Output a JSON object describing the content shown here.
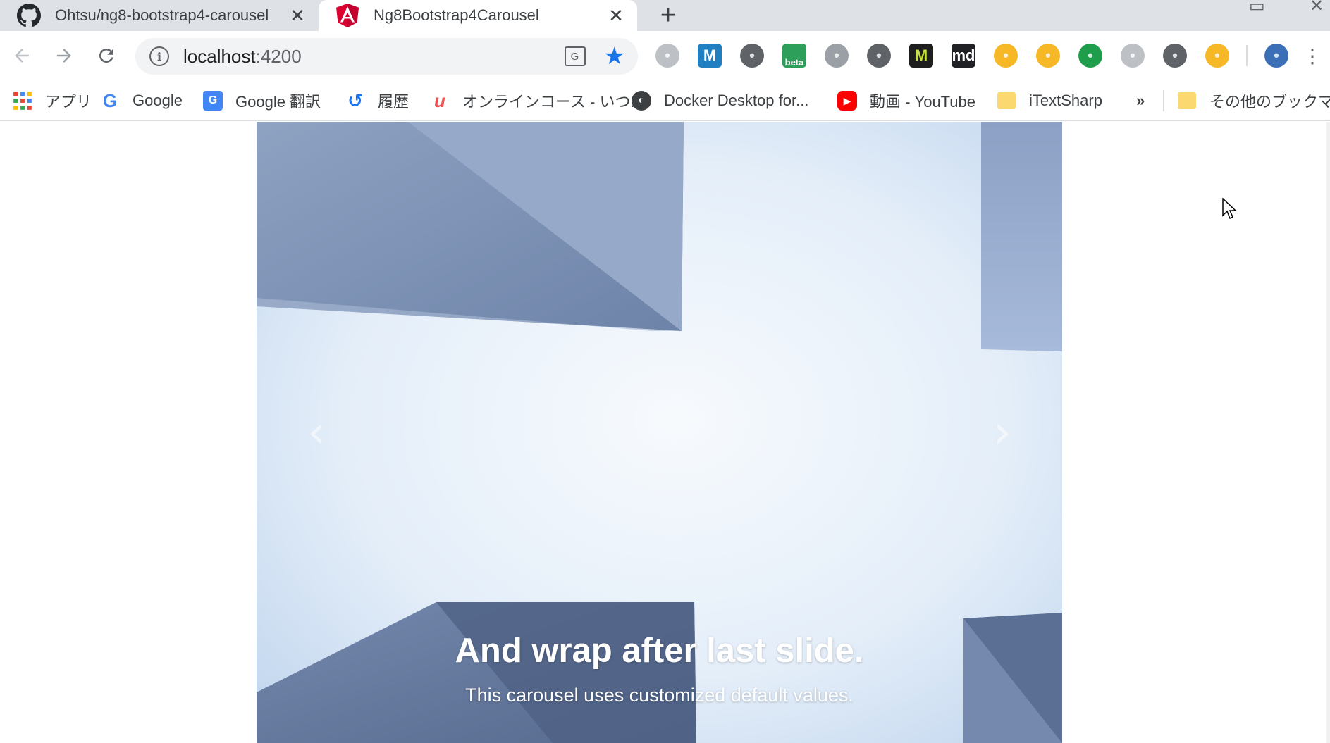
{
  "tabs": [
    {
      "title": "Ohtsu/ng8-bootstrap4-carousel",
      "icon": "github-icon",
      "active": false
    },
    {
      "title": "Ng8Bootstrap4Carousel",
      "icon": "angular-icon",
      "active": true
    }
  ],
  "new_tab_label": "+",
  "address_bar": {
    "host": "localhost",
    "port": ":4200"
  },
  "extensions": [
    {
      "name": "shield-extension-icon",
      "color": "#bdc1c6",
      "label": ""
    },
    {
      "name": "m-blue-extension-icon",
      "color": "#1f7fc0",
      "label": "M"
    },
    {
      "name": "film-reel-extension-icon",
      "color": "#5f6368",
      "label": ""
    },
    {
      "name": "beta-extension-icon",
      "color": "#2e9e5b",
      "label": "beta"
    },
    {
      "name": "chart-extension-icon",
      "color": "#9aa0a6",
      "label": ""
    },
    {
      "name": "magnifier-extension-icon",
      "color": "#5f6368",
      "label": ""
    },
    {
      "name": "m-yellow-extension-icon",
      "color": "#1e1e1e",
      "label": "M"
    },
    {
      "name": "md-extension-icon",
      "color": "#202124",
      "label": "md"
    },
    {
      "name": "search-orange-extension-icon",
      "color": "#f6b826",
      "label": ""
    },
    {
      "name": "home-extension-icon",
      "color": "#f6b826",
      "label": ""
    },
    {
      "name": "checkmark-extension-icon",
      "color": "#1e9e4a",
      "label": ""
    },
    {
      "name": "circle-extension-icon",
      "color": "#bdc1c6",
      "label": ""
    },
    {
      "name": "zoom-extension-icon",
      "color": "#5f6368",
      "label": ""
    },
    {
      "name": "moon-extension-icon",
      "color": "#f6b826",
      "label": ""
    },
    {
      "name": "profile-extension-icon",
      "color": "#3b6fb6",
      "label": ""
    }
  ],
  "bookmarks": [
    {
      "label": "アプリ",
      "icon": "apps-grid-icon"
    },
    {
      "label": "Google",
      "icon": "google-icon"
    },
    {
      "label": "Google 翻訳",
      "icon": "google-translate-icon"
    },
    {
      "label": "履歴",
      "icon": "history-icon"
    },
    {
      "label": "オンラインコース - いつ...",
      "icon": "udemy-icon"
    },
    {
      "label": "Docker Desktop for...",
      "icon": "docker-icon"
    },
    {
      "label": "動画 - YouTube",
      "icon": "youtube-icon"
    },
    {
      "label": "iTextSharp",
      "icon": "folder-icon"
    }
  ],
  "bookmarks_overflow": "»",
  "other_bookmarks": "その他のブックマーク",
  "carousel": {
    "heading": "And wrap after last slide.",
    "text": "This carousel uses customized default values.",
    "prev_glyph": "‹",
    "next_glyph": "›"
  },
  "colors": {
    "tabstrip_bg": "#dee1e6",
    "accent_blue": "#1a73e8",
    "sky_light": "#eef4fb",
    "sky_mid": "#c9dbf0",
    "concrete": "#7f94b5"
  }
}
